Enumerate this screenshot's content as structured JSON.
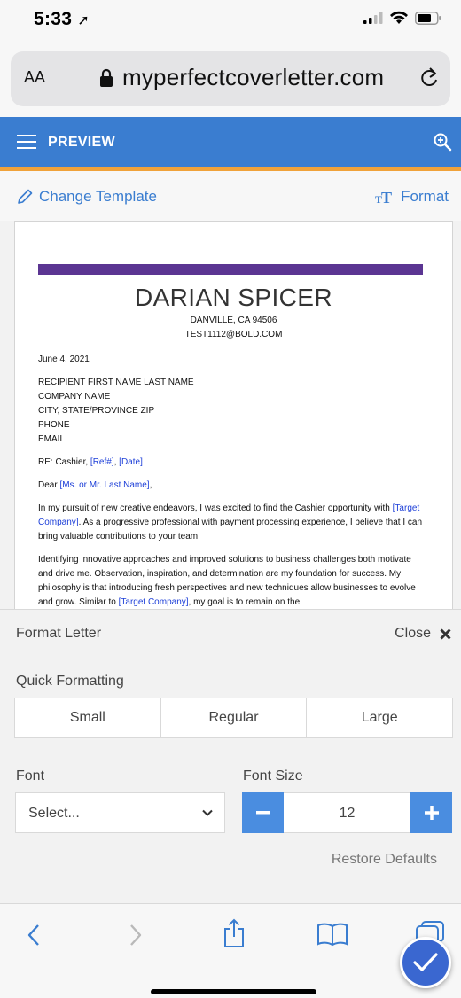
{
  "status": {
    "time": "5:33"
  },
  "browser": {
    "aa_label": "AA",
    "url": "myperfectcoverletter.com"
  },
  "header": {
    "title": "PREVIEW"
  },
  "toolbar": {
    "change_template": "Change Template",
    "format": "Format"
  },
  "letter": {
    "name": "DARIAN SPICER",
    "city": "DANVILLE, CA 94506",
    "email": "TEST1112@BOLD.COM",
    "date": "June 4, 2021",
    "recipient_lines": [
      "RECIPIENT FIRST NAME LAST NAME",
      "COMPANY NAME",
      "CITY, STATE/PROVINCE ZIP",
      "PHONE",
      "EMAIL"
    ],
    "re_prefix": "RE: Cashier, ",
    "re_ref": "[Ref#]",
    "re_sep": ", ",
    "re_date": "[Date]",
    "dear_prefix": "Dear ",
    "dear_name": "[Ms. or Mr. Last Name]",
    "dear_suffix": ",",
    "p1_a": "In my pursuit of new creative endeavors, I was excited to find the Cashier opportunity with ",
    "p1_company": "[Target Company]",
    "p1_b": ". As a progressive professional with payment processing experience, I believe that I can bring valuable contributions to your team.",
    "p2_a": "Identifying innovative approaches and improved solutions to business challenges both motivate and drive me. Observation, inspiration, and determination are my foundation for success. My philosophy is that introducing fresh perspectives and new techniques allow businesses to evolve and grow. Similar to ",
    "p2_company": "[Target Company]",
    "p2_b": ", my goal is to remain on the"
  },
  "format_panel": {
    "title": "Format Letter",
    "close": "Close",
    "quick_label": "Quick Formatting",
    "quick_options": [
      "Small",
      "Regular",
      "Large"
    ],
    "font_label": "Font",
    "font_placeholder": "Select...",
    "size_label": "Font Size",
    "size_value": "12",
    "restore": "Restore Defaults"
  },
  "colors": {
    "brand_blue": "#3a7dd0",
    "accent_orange": "#f0a23a",
    "letter_bar": "#5b3592",
    "placeholder_blue": "#1d3fd8"
  }
}
